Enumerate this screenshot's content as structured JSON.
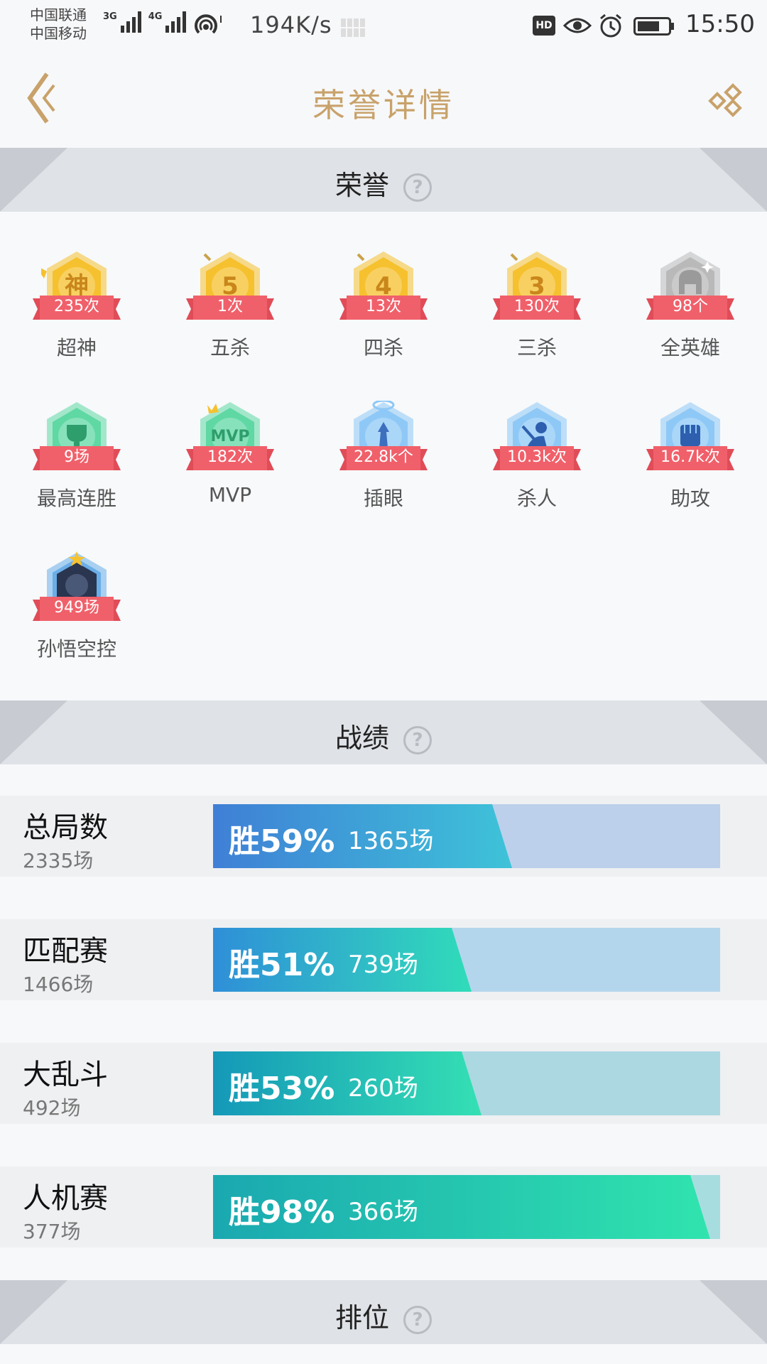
{
  "status_bar": {
    "carrier1": "中国联通",
    "carrier2": "中国移动",
    "net1": "3G",
    "net2": "4G",
    "speed": "194K/s",
    "hd": "HD",
    "time": "15:50"
  },
  "header": {
    "title": "荣誉详情"
  },
  "sections": {
    "honor": "荣誉",
    "record": "战绩",
    "rank": "排位",
    "help_glyph": "?"
  },
  "honors": [
    {
      "label": "超神",
      "count": "235次",
      "emblem": "神",
      "color": "#f6c12e",
      "icon": "wings-icon"
    },
    {
      "label": "五杀",
      "count": "1次",
      "emblem": "5",
      "color": "#f6c12e",
      "icon": "sword-icon"
    },
    {
      "label": "四杀",
      "count": "13次",
      "emblem": "4",
      "color": "#f6c12e",
      "icon": "sword-icon"
    },
    {
      "label": "三杀",
      "count": "130次",
      "emblem": "3",
      "color": "#f6c12e",
      "icon": "sword-icon"
    },
    {
      "label": "全英雄",
      "count": "98个",
      "emblem": "",
      "color": "#b9b9b9",
      "icon": "helmet-icon"
    },
    {
      "label": "最高连胜",
      "count": "9场",
      "emblem": "",
      "color": "#5fd8a4",
      "icon": "trophy-icon"
    },
    {
      "label": "MVP",
      "count": "182次",
      "emblem": "MVP",
      "color": "#5fd8a4",
      "icon": "crown-icon"
    },
    {
      "label": "插眼",
      "count": "22.8k个",
      "emblem": "",
      "color": "#8ec8f6",
      "icon": "ward-icon"
    },
    {
      "label": "杀人",
      "count": "10.3k次",
      "emblem": "",
      "color": "#8ec8f6",
      "icon": "kill-icon"
    },
    {
      "label": "助攻",
      "count": "16.7k次",
      "emblem": "",
      "color": "#8ec8f6",
      "icon": "fist-icon"
    },
    {
      "label": "孙悟空控",
      "count": "949场",
      "emblem": "",
      "color": "#6aaee8",
      "icon": "hero-portrait-icon"
    }
  ],
  "stats": [
    {
      "mode": "总局数",
      "total": "2335场",
      "pct_label": "胜59%",
      "wins": "1365场",
      "win_rate": 0.59,
      "fill_from": "#3f7fd6",
      "fill_to": "#3ec3d8",
      "track": "#bcd0ec"
    },
    {
      "mode": "匹配赛",
      "total": "1466场",
      "pct_label": "胜51%",
      "wins": "739场",
      "win_rate": 0.51,
      "fill_from": "#2f8fd8",
      "fill_to": "#30dcb9",
      "track": "#b4d6ec"
    },
    {
      "mode": "大乱斗",
      "total": "492场",
      "pct_label": "胜53%",
      "wins": "260场",
      "win_rate": 0.53,
      "fill_from": "#1498b8",
      "fill_to": "#35e0b4",
      "track": "#acd8e2"
    },
    {
      "mode": "人机赛",
      "total": "377场",
      "pct_label": "胜98%",
      "wins": "366场",
      "win_rate": 0.98,
      "fill_from": "#1aa8b0",
      "fill_to": "#30e4ae",
      "track": "#a8dde0"
    }
  ],
  "colors": {
    "accent": "#c8a26a",
    "ribbon": "#f0606a"
  }
}
